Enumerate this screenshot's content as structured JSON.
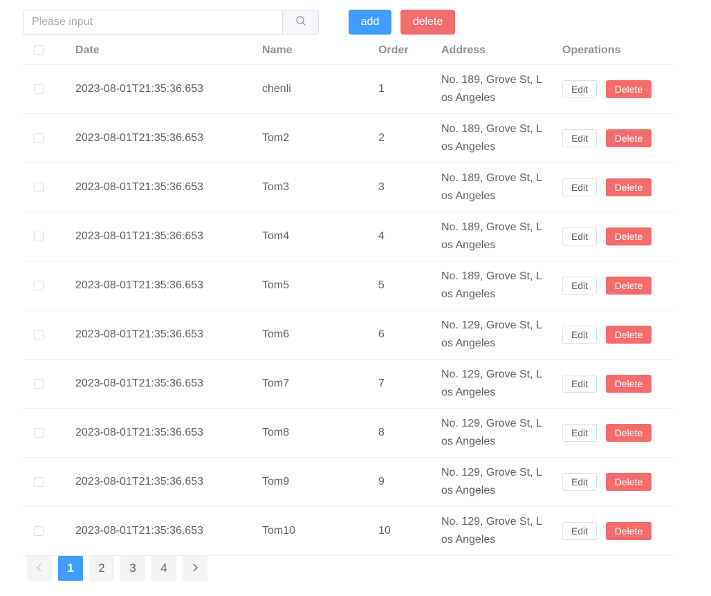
{
  "search": {
    "placeholder": "Please input",
    "icon": "search-icon"
  },
  "toolbar": {
    "add_label": "add",
    "delete_label": "delete",
    "accent": "#409eff",
    "danger": "#f56c6c"
  },
  "table": {
    "headers": {
      "date": "Date",
      "name": "Name",
      "order": "Order",
      "address": "Address",
      "operations": "Operations"
    },
    "rows": [
      {
        "date": "2023-08-01T21:35:36.653",
        "name": "chenli",
        "order": "1",
        "address": "No. 189, Grove St, Los Angeles",
        "edit": "Edit",
        "delete": "Delete"
      },
      {
        "date": "2023-08-01T21:35:36.653",
        "name": "Tom2",
        "order": "2",
        "address": "No. 189, Grove St, Los Angeles",
        "edit": "Edit",
        "delete": "Delete"
      },
      {
        "date": "2023-08-01T21:35:36.653",
        "name": "Tom3",
        "order": "3",
        "address": "No. 189, Grove St, Los Angeles",
        "edit": "Edit",
        "delete": "Delete"
      },
      {
        "date": "2023-08-01T21:35:36.653",
        "name": "Tom4",
        "order": "4",
        "address": "No. 189, Grove St, Los Angeles",
        "edit": "Edit",
        "delete": "Delete"
      },
      {
        "date": "2023-08-01T21:35:36.653",
        "name": "Tom5",
        "order": "5",
        "address": "No. 189, Grove St, Los Angeles",
        "edit": "Edit",
        "delete": "Delete"
      },
      {
        "date": "2023-08-01T21:35:36.653",
        "name": "Tom6",
        "order": "6",
        "address": "No. 129, Grove St, Los Angeles",
        "edit": "Edit",
        "delete": "Delete"
      },
      {
        "date": "2023-08-01T21:35:36.653",
        "name": "Tom7",
        "order": "7",
        "address": "No. 129, Grove St, Los Angeles",
        "edit": "Edit",
        "delete": "Delete"
      },
      {
        "date": "2023-08-01T21:35:36.653",
        "name": "Tom8",
        "order": "8",
        "address": "No. 129, Grove St, Los Angeles",
        "edit": "Edit",
        "delete": "Delete"
      },
      {
        "date": "2023-08-01T21:35:36.653",
        "name": "Tom9",
        "order": "9",
        "address": "No. 129, Grove St, Los Angeles",
        "edit": "Edit",
        "delete": "Delete"
      },
      {
        "date": "2023-08-01T21:35:36.653",
        "name": "Tom10",
        "order": "10",
        "address": "No. 129, Grove St, Los Angeles",
        "edit": "Edit",
        "delete": "Delete"
      }
    ]
  },
  "pagination": {
    "prev_icon": "chevron-left-icon",
    "next_icon": "chevron-right-icon",
    "pages": [
      "1",
      "2",
      "3",
      "4"
    ],
    "current": "1"
  }
}
